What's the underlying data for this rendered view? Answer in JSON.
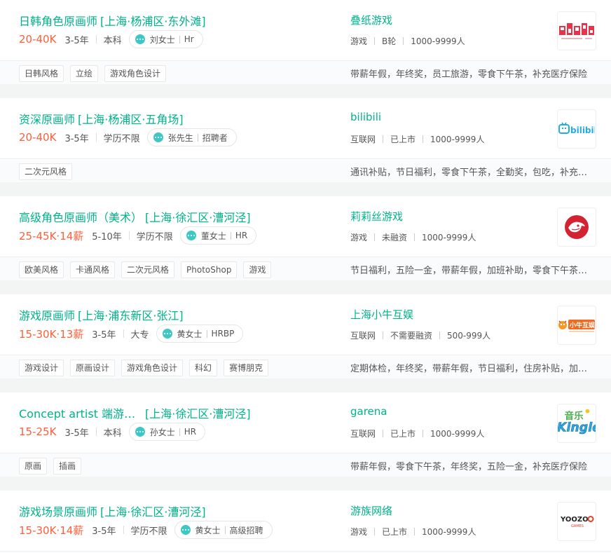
{
  "jobs": [
    {
      "title": "日韩角色原画师",
      "location": "[上海·杨浦区·东外滩]",
      "salary": "20-40K",
      "experience": "3-5年",
      "education": "本科",
      "recruiter_name": "刘女士",
      "recruiter_role": "Hr",
      "company": "叠纸游戏",
      "industry": "游戏",
      "funding": "B轮",
      "size": "1000-9999人",
      "tags": [
        "日韩风格",
        "立绘",
        "游戏角色设计"
      ],
      "welfare": "带薪年假，年终奖，员工旅游，零食下午茶，补充医疗保险",
      "logo_icon": "papergames-logo"
    },
    {
      "title": "资深原画师",
      "location": "[上海·杨浦区·五角场]",
      "salary": "20-40K",
      "experience": "3-5年",
      "education": "学历不限",
      "recruiter_name": "张先生",
      "recruiter_role": "招聘者",
      "company": "bilibili",
      "industry": "互联网",
      "funding": "已上市",
      "size": "1000-9999人",
      "tags": [
        "二次元风格"
      ],
      "welfare": "通讯补贴，节日福利，零食下午茶，全勤奖，包吃，补充医疗保险",
      "logo_icon": "bilibili-logo"
    },
    {
      "title": "高级角色原画师（美术）",
      "location": "[上海·徐汇区·漕河泾]",
      "salary": "25-45K·14薪",
      "experience": "5-10年",
      "education": "学历不限",
      "recruiter_name": "董女士",
      "recruiter_role": "HR",
      "company": "莉莉丝游戏",
      "industry": "游戏",
      "funding": "未融资",
      "size": "1000-9999人",
      "tags": [
        "欧美风格",
        "卡通风格",
        "二次元风格",
        "PhotoShop",
        "游戏"
      ],
      "welfare": "节日福利，五险一金，带薪年假，加班补助，零食下午茶，年终奖",
      "logo_icon": "lilith-logo"
    },
    {
      "title": "游戏原画师",
      "location": "[上海·浦东新区·张江]",
      "salary": "15-30K·13薪",
      "experience": "3-5年",
      "education": "大专",
      "recruiter_name": "黄女士",
      "recruiter_role": "HRBP",
      "company": "上海小牛互娱",
      "industry": "互联网",
      "funding": "不需要融资",
      "size": "500-999人",
      "tags": [
        "游戏设计",
        "原画设计",
        "游戏角色设计",
        "科幻",
        "赛博朋克"
      ],
      "welfare": "定期体检，年终奖，带薪年假，节日福利，住房补贴，加班补助",
      "logo_icon": "xiaoniu-logo",
      "logo_text": "小牛互娱"
    },
    {
      "title": "Concept artist 端游手游",
      "location": "[上海·徐汇区·漕河泾]",
      "salary": "15-25K",
      "experience": "3-5年",
      "education": "本科",
      "recruiter_name": "孙女士",
      "recruiter_role": "HR",
      "company": "garena",
      "industry": "互联网",
      "funding": "已上市",
      "size": "1000-9999人",
      "tags": [
        "原画",
        "插画"
      ],
      "welfare": "带薪年假，零食下午茶，年终奖，五险一金，补充医疗保险",
      "logo_icon": "garena-kingle-logo"
    },
    {
      "title": "游戏场景原画师",
      "location": "[上海·徐汇区·漕河泾]",
      "salary": "15-30K·14薪",
      "experience": "3-5年",
      "education": "学历不限",
      "recruiter_name": "黄女士",
      "recruiter_role": "高级招聘",
      "company": "游族网络",
      "industry": "游戏",
      "funding": "已上市",
      "size": "1000-9999人",
      "tags": [],
      "welfare": "",
      "logo_icon": "yoozoo-logo",
      "logo_text": "YOOZOO"
    }
  ],
  "colors": {
    "accent": "#00b38a",
    "salary": "#fd5f39",
    "chat": "#3fc8c3"
  }
}
